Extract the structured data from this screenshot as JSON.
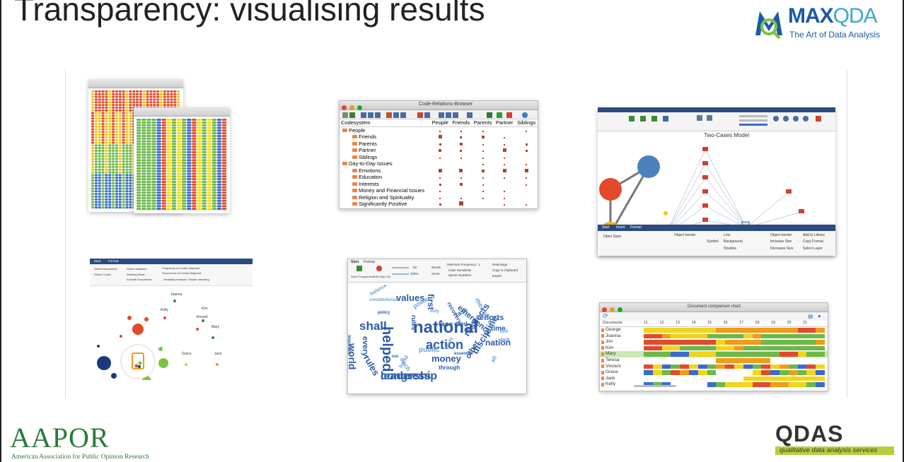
{
  "slide": {
    "title": "Transparency: visualising results"
  },
  "logos": {
    "maxqda_name_a": "MAX",
    "maxqda_name_b": "QDA",
    "maxqda_tagline": "The Art of Data Analysis",
    "aapor_name": "AAPOR",
    "aapor_full": "American Association for Public Opinion Research",
    "qdas_name": "QDAS",
    "qdas_tagline": "qualitative data analysis services"
  },
  "colors": {
    "maxqda_blue": "#1b5aa8",
    "aapor_green": "#2a7a3a",
    "qdas_green": "#b7cf3d",
    "code_square": "#b04432",
    "cloud_blue": "#2d5aa6"
  },
  "code_relations_browser": {
    "window_title": "Code-Relations-Browser",
    "columns": [
      "Codesystem",
      "People",
      "Friends",
      "Parents",
      "Partner",
      "Siblings"
    ],
    "rows": [
      {
        "label": "People",
        "level": 0
      },
      {
        "label": "Friends",
        "level": 1
      },
      {
        "label": "Parents",
        "level": 1
      },
      {
        "label": "Partner",
        "level": 1
      },
      {
        "label": "Siblings",
        "level": 1
      },
      {
        "label": "Day-to-Day Issues",
        "level": 0
      },
      {
        "label": "Emotions",
        "level": 1
      },
      {
        "label": "Education",
        "level": 1
      },
      {
        "label": "Interests",
        "level": 1
      },
      {
        "label": "Money and Financial Issues",
        "level": 1
      },
      {
        "label": "Religion and Spirituality",
        "level": 1
      },
      {
        "label": "Significantly Positive",
        "level": 1
      }
    ]
  },
  "two_cases_model": {
    "title": "Two-Cases Model",
    "tabs": [
      "Start",
      "Insert",
      "Format"
    ],
    "toolbar_items": [
      "Open Sans",
      "Object border",
      "Line",
      "Background",
      "Symbol",
      "Shadow",
      "Add to Library",
      "Copy Format",
      "Select Layer",
      "Increase Size",
      "Decrease Size",
      "Object border"
    ]
  },
  "word_frequencies": {
    "tabs": [
      "Start",
      "Format"
    ],
    "buttons": [
      "Word Frequencies",
      "Edit Stop List"
    ],
    "options": [
      "Words",
      "Zoom",
      "Minimum Frequency:",
      "Case Sensitivity",
      "Ignore Numbers",
      "Rearrange",
      "Copy to Clipboard",
      "Export"
    ],
    "values": {
      "words": "60",
      "zoom": "100%",
      "min_frequency": "1"
    },
    "words": [
      "values",
      "constitutional",
      "shall",
      "national",
      "action",
      "leadership",
      "money",
      "nation",
      "efforts",
      "time",
      "face",
      "need",
      "emergency",
      "respects",
      "discipline",
      "world",
      "every",
      "public",
      "first",
      "policy",
      "rules",
      "essential",
      "through",
      "our",
      "other",
      "task",
      "power",
      "dark",
      "still",
      "helped",
      "measures",
      "important",
      "balance",
      "such",
      "hand",
      "duty",
      "profit",
      "recovery",
      "rules",
      "congress",
      "all",
      "leadership",
      "great"
    ]
  },
  "network_map": {
    "tabs": [
      "Start",
      "Format"
    ],
    "names": [
      "Joanna",
      "Kelly",
      "Kim",
      "Vincent",
      "Mary",
      "Grace",
      "Jack"
    ],
    "options": [
      "Select Documents",
      "Select Codes",
      "Select Variables",
      "Working Mode",
      "Frequency of Coded Segment",
      "Occurrence of Coded Segment",
      "Similarity measure: Simple matching",
      "Exclude Documents"
    ]
  },
  "document_comparison_chart": {
    "window_title": "Document comparison chart",
    "columns": [
      "Documents",
      "11",
      "12",
      "13",
      "14",
      "15",
      "16",
      "17",
      "18",
      "19",
      "20",
      "21"
    ],
    "documents": [
      "George",
      "Joanna",
      "Jim",
      "Kim",
      "Mary",
      "Teresa",
      "Vincent",
      "Grace",
      "Jack",
      "Kelly"
    ]
  }
}
